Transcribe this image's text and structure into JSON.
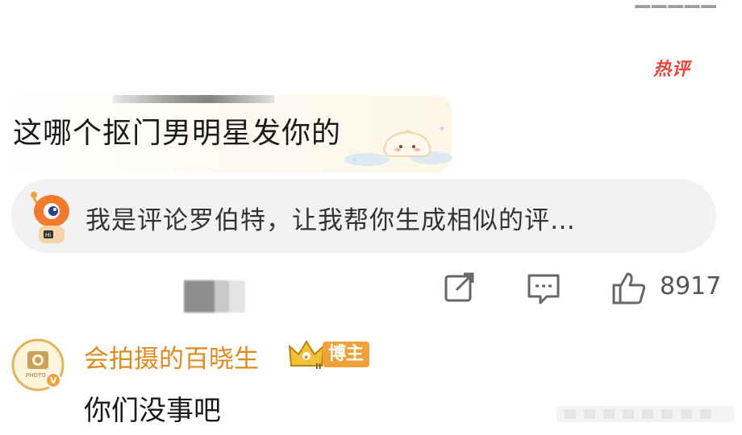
{
  "hot_comment": {
    "badge": "热评",
    "text": "这哪个抠门男明星发你的"
  },
  "robot_suggestion": {
    "text": "我是评论罗伯特，让我帮你生成相似的评…",
    "avatar_icon": "robot-mascot-icon"
  },
  "actions": {
    "share_icon": "share-icon",
    "comment_icon": "comment-icon",
    "like_icon": "thumbs-up-icon",
    "like_count": "8917"
  },
  "reply": {
    "username": "会拍摄的百晓生",
    "tag": "博主",
    "text": "你们没事吧",
    "accent_color": "#e08a1e"
  },
  "colors": {
    "hot_badge": "#e8453c",
    "blogger_tag": "#f0a23a",
    "robot_card_bg": "#f2f2f3"
  }
}
